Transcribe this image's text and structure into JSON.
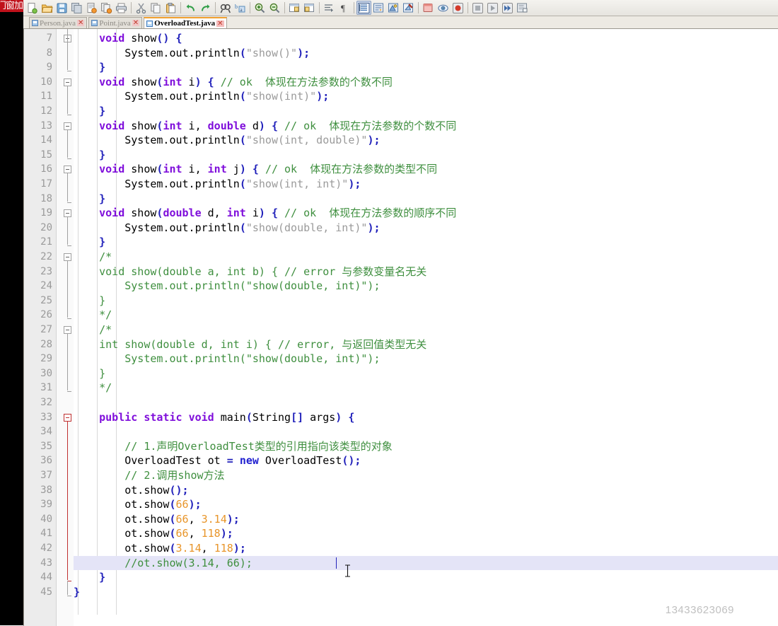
{
  "banner": {
    "text": "门窗加"
  },
  "toolbar": {
    "buttons": [
      {
        "name": "new-file-icon",
        "label": "New"
      },
      {
        "name": "open-folder-icon",
        "label": "Open"
      },
      {
        "name": "save-icon",
        "label": "Save"
      },
      {
        "name": "save-all-icon",
        "label": "Save All"
      },
      {
        "name": "save-as-icon",
        "label": "Save As"
      },
      {
        "name": "save-copy-icon",
        "label": "Save a Copy"
      },
      {
        "name": "print-icon",
        "label": "Print"
      },
      {
        "name": "cut-icon",
        "label": "Cut"
      },
      {
        "name": "copy-icon",
        "label": "Copy"
      },
      {
        "name": "paste-icon",
        "label": "Paste"
      },
      {
        "name": "undo-icon",
        "label": "Undo"
      },
      {
        "name": "redo-icon",
        "label": "Redo"
      },
      {
        "name": "find-icon",
        "label": "Find"
      },
      {
        "name": "replace-icon",
        "label": "Replace"
      },
      {
        "name": "zoom-in-icon",
        "label": "Zoom In"
      },
      {
        "name": "zoom-out-icon",
        "label": "Zoom Out"
      },
      {
        "name": "sync-scroll-v-icon",
        "label": "Synchronize Vertical Scrolling"
      },
      {
        "name": "sync-scroll-h-icon",
        "label": "Synchronize Horizontal Scrolling"
      },
      {
        "name": "show-whitespace-icon",
        "label": "Show Whitespace and TAB"
      },
      {
        "name": "show-pilcrow-icon",
        "label": "Show End of Line"
      },
      {
        "name": "show-indent-guide-icon",
        "label": "Show Indent Guide"
      },
      {
        "name": "wrap-icon",
        "label": "Word Wrap"
      },
      {
        "name": "all-chars-icon",
        "label": "Show All Characters"
      },
      {
        "name": "user-defined-lang-icon",
        "label": "User Defined Language"
      },
      {
        "name": "document-map-icon",
        "label": "Document Map"
      },
      {
        "name": "function-list-icon",
        "label": "Function List"
      },
      {
        "name": "macro-record-icon",
        "label": "Start Recording"
      },
      {
        "name": "macro-stop-icon",
        "label": "Stop Recording"
      },
      {
        "name": "macro-play-icon",
        "label": "Playback"
      },
      {
        "name": "macro-run-multi-icon",
        "label": "Run a Macro Multiple Times"
      },
      {
        "name": "macro-save-icon",
        "label": "Save Current Recorded Macro"
      }
    ]
  },
  "tabs": [
    {
      "label": "Person.java",
      "active": false
    },
    {
      "label": "Point.java",
      "active": false
    },
    {
      "label": "OverloadTest.java",
      "active": true
    }
  ],
  "editor": {
    "first_line": 7,
    "last_line": 45,
    "current_line": 43,
    "watermark": "13433623069",
    "lines": [
      {
        "n": 7,
        "fold": "gray",
        "tokens": [
          [
            "plain",
            "    "
          ],
          [
            "kw",
            "void"
          ],
          [
            "plain",
            " show"
          ],
          [
            "pn",
            "()"
          ],
          [
            "plain",
            " "
          ],
          [
            "pn",
            "{"
          ]
        ]
      },
      {
        "n": 8,
        "tokens": [
          [
            "plain",
            "        System.out.println"
          ],
          [
            "pn",
            "("
          ],
          [
            "str",
            "\"show()\""
          ],
          [
            "pn",
            ")"
          ],
          [
            "pn",
            ";"
          ]
        ]
      },
      {
        "n": 9,
        "tick": "gray",
        "tokens": [
          [
            "plain",
            "    "
          ],
          [
            "pn",
            "}"
          ]
        ]
      },
      {
        "n": 10,
        "fold": "gray",
        "tokens": [
          [
            "plain",
            "    "
          ],
          [
            "kw",
            "void"
          ],
          [
            "plain",
            " show"
          ],
          [
            "pn",
            "("
          ],
          [
            "kw",
            "int"
          ],
          [
            "plain",
            " i"
          ],
          [
            "pn",
            ")"
          ],
          [
            "plain",
            " "
          ],
          [
            "pn",
            "{"
          ],
          [
            "plain",
            " "
          ],
          [
            "cm",
            "// ok  体现在方法参数的个数不同"
          ]
        ]
      },
      {
        "n": 11,
        "tokens": [
          [
            "plain",
            "        System.out.println"
          ],
          [
            "pn",
            "("
          ],
          [
            "str",
            "\"show(int)\""
          ],
          [
            "pn",
            ")"
          ],
          [
            "pn",
            ";"
          ]
        ]
      },
      {
        "n": 12,
        "tick": "gray",
        "tokens": [
          [
            "plain",
            "    "
          ],
          [
            "pn",
            "}"
          ]
        ]
      },
      {
        "n": 13,
        "fold": "gray",
        "tokens": [
          [
            "plain",
            "    "
          ],
          [
            "kw",
            "void"
          ],
          [
            "plain",
            " show"
          ],
          [
            "pn",
            "("
          ],
          [
            "kw",
            "int"
          ],
          [
            "plain",
            " i, "
          ],
          [
            "kw",
            "double"
          ],
          [
            "plain",
            " d"
          ],
          [
            "pn",
            ")"
          ],
          [
            "plain",
            " "
          ],
          [
            "pn",
            "{"
          ],
          [
            "plain",
            " "
          ],
          [
            "cm",
            "// ok  体现在方法参数的个数不同"
          ]
        ]
      },
      {
        "n": 14,
        "tokens": [
          [
            "plain",
            "        System.out.println"
          ],
          [
            "pn",
            "("
          ],
          [
            "str",
            "\"show(int, double)\""
          ],
          [
            "pn",
            ")"
          ],
          [
            "pn",
            ";"
          ]
        ]
      },
      {
        "n": 15,
        "tick": "gray",
        "tokens": [
          [
            "plain",
            "    "
          ],
          [
            "pn",
            "}"
          ]
        ]
      },
      {
        "n": 16,
        "fold": "gray",
        "tokens": [
          [
            "plain",
            "    "
          ],
          [
            "kw",
            "void"
          ],
          [
            "plain",
            " show"
          ],
          [
            "pn",
            "("
          ],
          [
            "kw",
            "int"
          ],
          [
            "plain",
            " i, "
          ],
          [
            "kw",
            "int"
          ],
          [
            "plain",
            " j"
          ],
          [
            "pn",
            ")"
          ],
          [
            "plain",
            " "
          ],
          [
            "pn",
            "{"
          ],
          [
            "plain",
            " "
          ],
          [
            "cm",
            "// ok  体现在方法参数的类型不同"
          ]
        ]
      },
      {
        "n": 17,
        "tokens": [
          [
            "plain",
            "        System.out.println"
          ],
          [
            "pn",
            "("
          ],
          [
            "str",
            "\"show(int, int)\""
          ],
          [
            "pn",
            ")"
          ],
          [
            "pn",
            ";"
          ]
        ]
      },
      {
        "n": 18,
        "tick": "gray",
        "tokens": [
          [
            "plain",
            "    "
          ],
          [
            "pn",
            "}"
          ]
        ]
      },
      {
        "n": 19,
        "fold": "gray",
        "tokens": [
          [
            "plain",
            "    "
          ],
          [
            "kw",
            "void"
          ],
          [
            "plain",
            " show"
          ],
          [
            "pn",
            "("
          ],
          [
            "kw",
            "double"
          ],
          [
            "plain",
            " d, "
          ],
          [
            "kw",
            "int"
          ],
          [
            "plain",
            " i"
          ],
          [
            "pn",
            ")"
          ],
          [
            "plain",
            " "
          ],
          [
            "pn",
            "{"
          ],
          [
            "plain",
            " "
          ],
          [
            "cm",
            "// ok  体现在方法参数的顺序不同"
          ]
        ]
      },
      {
        "n": 20,
        "tokens": [
          [
            "plain",
            "        System.out.println"
          ],
          [
            "pn",
            "("
          ],
          [
            "str",
            "\"show(double, int)\""
          ],
          [
            "pn",
            ")"
          ],
          [
            "pn",
            ";"
          ]
        ]
      },
      {
        "n": 21,
        "tick": "gray",
        "tokens": [
          [
            "plain",
            "    "
          ],
          [
            "pn",
            "}"
          ]
        ]
      },
      {
        "n": 22,
        "fold": "gray",
        "tokens": [
          [
            "cm",
            "    /*"
          ]
        ]
      },
      {
        "n": 23,
        "tokens": [
          [
            "cm",
            "    void show(double a, int b) { // error 与参数变量名无关"
          ]
        ]
      },
      {
        "n": 24,
        "tokens": [
          [
            "cm",
            "        System.out.println(\"show(double, int)\");"
          ]
        ]
      },
      {
        "n": 25,
        "tokens": [
          [
            "cm",
            "    }"
          ]
        ]
      },
      {
        "n": 26,
        "tick": "gray",
        "tokens": [
          [
            "cm",
            "    */"
          ]
        ]
      },
      {
        "n": 27,
        "fold": "gray",
        "tokens": [
          [
            "cm",
            "    /*"
          ]
        ]
      },
      {
        "n": 28,
        "tokens": [
          [
            "cm",
            "    int show(double d, int i) { // error, 与返回值类型无关"
          ]
        ]
      },
      {
        "n": 29,
        "tokens": [
          [
            "cm",
            "        System.out.println(\"show(double, int)\");"
          ]
        ]
      },
      {
        "n": 30,
        "tokens": [
          [
            "cm",
            "    }"
          ]
        ]
      },
      {
        "n": 31,
        "tick": "gray",
        "tokens": [
          [
            "cm",
            "    */"
          ]
        ]
      },
      {
        "n": 32,
        "tokens": []
      },
      {
        "n": 33,
        "fold": "red",
        "tokens": [
          [
            "plain",
            "    "
          ],
          [
            "kw",
            "public"
          ],
          [
            "plain",
            " "
          ],
          [
            "kw",
            "static"
          ],
          [
            "plain",
            " "
          ],
          [
            "kw",
            "void"
          ],
          [
            "plain",
            " main"
          ],
          [
            "pn",
            "("
          ],
          [
            "plain",
            "String"
          ],
          [
            "pn",
            "[]"
          ],
          [
            "plain",
            " args"
          ],
          [
            "pn",
            ")"
          ],
          [
            "plain",
            " "
          ],
          [
            "pn",
            "{"
          ]
        ]
      },
      {
        "n": 34,
        "tokens": []
      },
      {
        "n": 35,
        "tokens": [
          [
            "plain",
            "        "
          ],
          [
            "cm",
            "// 1.声明OverloadTest类型的引用指向该类型的对象"
          ]
        ]
      },
      {
        "n": 36,
        "tokens": [
          [
            "plain",
            "        OverloadTest ot "
          ],
          [
            "pn",
            "="
          ],
          [
            "plain",
            " "
          ],
          [
            "kw2",
            "new"
          ],
          [
            "plain",
            " OverloadTest"
          ],
          [
            "pn",
            "()"
          ],
          [
            "pn",
            ";"
          ]
        ]
      },
      {
        "n": 37,
        "tokens": [
          [
            "plain",
            "        "
          ],
          [
            "cm",
            "// 2.调用show方法"
          ]
        ]
      },
      {
        "n": 38,
        "tokens": [
          [
            "plain",
            "        ot.show"
          ],
          [
            "pn",
            "()"
          ],
          [
            "pn",
            ";"
          ]
        ]
      },
      {
        "n": 39,
        "tokens": [
          [
            "plain",
            "        ot.show"
          ],
          [
            "pn",
            "("
          ],
          [
            "num",
            "66"
          ],
          [
            "pn",
            ")"
          ],
          [
            "pn",
            ";"
          ]
        ]
      },
      {
        "n": 40,
        "tokens": [
          [
            "plain",
            "        ot.show"
          ],
          [
            "pn",
            "("
          ],
          [
            "num",
            "66"
          ],
          [
            "plain",
            ", "
          ],
          [
            "num",
            "3.14"
          ],
          [
            "pn",
            ")"
          ],
          [
            "pn",
            ";"
          ]
        ]
      },
      {
        "n": 41,
        "tokens": [
          [
            "plain",
            "        ot.show"
          ],
          [
            "pn",
            "("
          ],
          [
            "num",
            "66"
          ],
          [
            "plain",
            ", "
          ],
          [
            "num",
            "118"
          ],
          [
            "pn",
            ")"
          ],
          [
            "pn",
            ";"
          ]
        ]
      },
      {
        "n": 42,
        "tokens": [
          [
            "plain",
            "        ot.show"
          ],
          [
            "pn",
            "("
          ],
          [
            "num",
            "3.14"
          ],
          [
            "plain",
            ", "
          ],
          [
            "num",
            "118"
          ],
          [
            "pn",
            ")"
          ],
          [
            "pn",
            ";"
          ]
        ]
      },
      {
        "n": 43,
        "highlight": true,
        "caret": true,
        "tokens": [
          [
            "plain",
            "        "
          ],
          [
            "cm",
            "//ot.show(3.14, 66);"
          ]
        ]
      },
      {
        "n": 44,
        "tick": "red",
        "tokens": [
          [
            "plain",
            "    "
          ],
          [
            "pn",
            "}"
          ]
        ]
      },
      {
        "n": 45,
        "tick": "gray",
        "tokens": [
          [
            "pn",
            "}"
          ]
        ]
      }
    ]
  }
}
